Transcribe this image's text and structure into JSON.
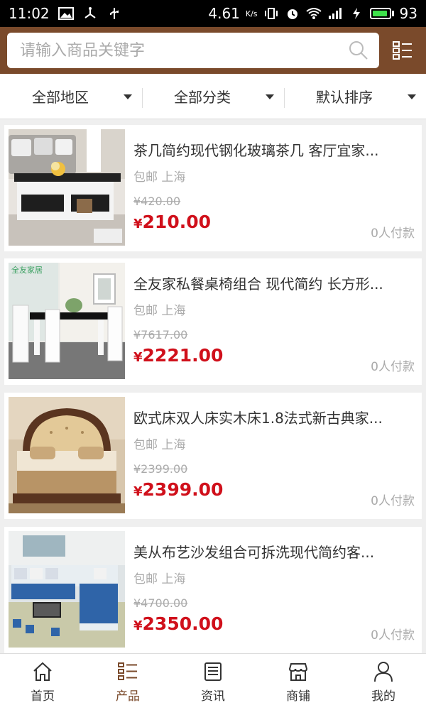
{
  "status": {
    "time": "11:02",
    "speed": "4.61",
    "speed_unit": "K/s",
    "battery": "93",
    "battery_level": 0.93
  },
  "search": {
    "placeholder": "请输入商品关键字"
  },
  "filters": [
    {
      "label": "全部地区"
    },
    {
      "label": "全部分类"
    },
    {
      "label": "默认排序"
    }
  ],
  "products": [
    {
      "title": "茶几简约现代钢化玻璃茶几 客厅宜家...",
      "shipping": "包邮 上海",
      "old_price": "¥420.00",
      "currency": "¥",
      "price": "210.00",
      "sold": "0人付款"
    },
    {
      "title": "全友家私餐桌椅组合 现代简约 长方形...",
      "shipping": "包邮 上海",
      "old_price": "¥7617.00",
      "currency": "¥",
      "price": "2221.00",
      "sold": "0人付款",
      "brand": "全友家居"
    },
    {
      "title": "欧式床双人床实木床1.8法式新古典家...",
      "shipping": "包邮 上海",
      "old_price": "¥2399.00",
      "currency": "¥",
      "price": "2399.00",
      "sold": "0人付款"
    },
    {
      "title": "美从布艺沙发组合可拆洗现代简约客...",
      "shipping": "包邮 上海",
      "old_price": "¥4700.00",
      "currency": "¥",
      "price": "2350.00",
      "sold": "0人付款"
    }
  ],
  "tabs": [
    {
      "label": "首页",
      "icon": "home-icon"
    },
    {
      "label": "产品",
      "icon": "list-icon"
    },
    {
      "label": "资讯",
      "icon": "news-icon"
    },
    {
      "label": "商铺",
      "icon": "shop-icon"
    },
    {
      "label": "我的",
      "icon": "user-icon"
    }
  ],
  "colors": {
    "header": "#7a4a2b",
    "price": "#d0101b",
    "active_tab": "#7a4a2b"
  }
}
